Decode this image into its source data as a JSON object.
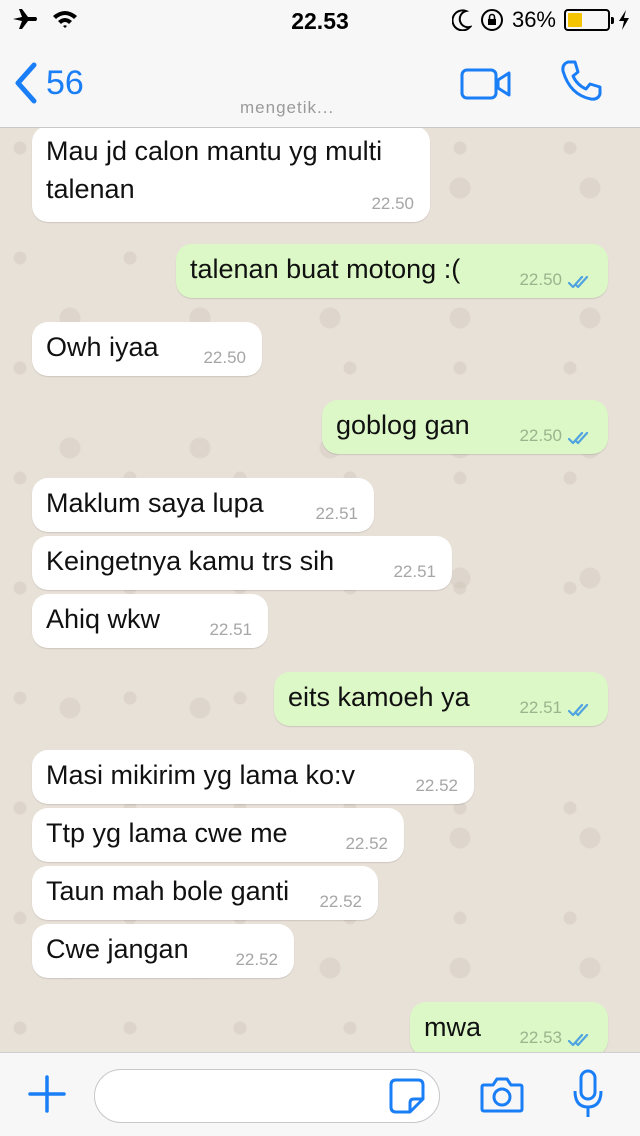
{
  "status_bar": {
    "time": "22.53",
    "battery_percent": "36%",
    "battery_level": 0.36
  },
  "nav": {
    "back_count": "56",
    "typing": "mengetik..."
  },
  "messages": [
    {
      "dir": "in",
      "lines": [
        "Mau jd calon mantu yg multi",
        "talenan"
      ],
      "time": "22.50"
    },
    {
      "dir": "out",
      "lines": [
        "talenan buat motong :("
      ],
      "time": "22.50"
    },
    {
      "dir": "in",
      "lines": [
        "Owh iyaa"
      ],
      "time": "22.50"
    },
    {
      "dir": "out",
      "lines": [
        "goblog gan"
      ],
      "time": "22.50"
    },
    {
      "dir": "in",
      "lines": [
        "Maklum saya lupa"
      ],
      "time": "22.51"
    },
    {
      "dir": "in",
      "lines": [
        "Keingetnya kamu trs sih"
      ],
      "time": "22.51"
    },
    {
      "dir": "in",
      "lines": [
        "Ahiq wkw"
      ],
      "time": "22.51"
    },
    {
      "dir": "out",
      "lines": [
        "eits kamoeh ya"
      ],
      "time": "22.51"
    },
    {
      "dir": "in",
      "lines": [
        "Masi mikirim yg lama ko:v"
      ],
      "time": "22.52"
    },
    {
      "dir": "in",
      "lines": [
        "Ttp yg lama cwe me"
      ],
      "time": "22.52"
    },
    {
      "dir": "in",
      "lines": [
        "Taun mah bole ganti"
      ],
      "time": "22.52"
    },
    {
      "dir": "in",
      "lines": [
        "Cwe jangan"
      ],
      "time": "22.52"
    },
    {
      "dir": "out",
      "lines": [
        "mwa"
      ],
      "time": "22.53"
    }
  ],
  "input": {
    "placeholder": ""
  },
  "colors": {
    "accent": "#1a7ef7",
    "outgoing_bubble": "#dcf8c6",
    "incoming_bubble": "#ffffff",
    "read_ticks": "#4fa3e0",
    "battery_fill": "#f5c400"
  }
}
